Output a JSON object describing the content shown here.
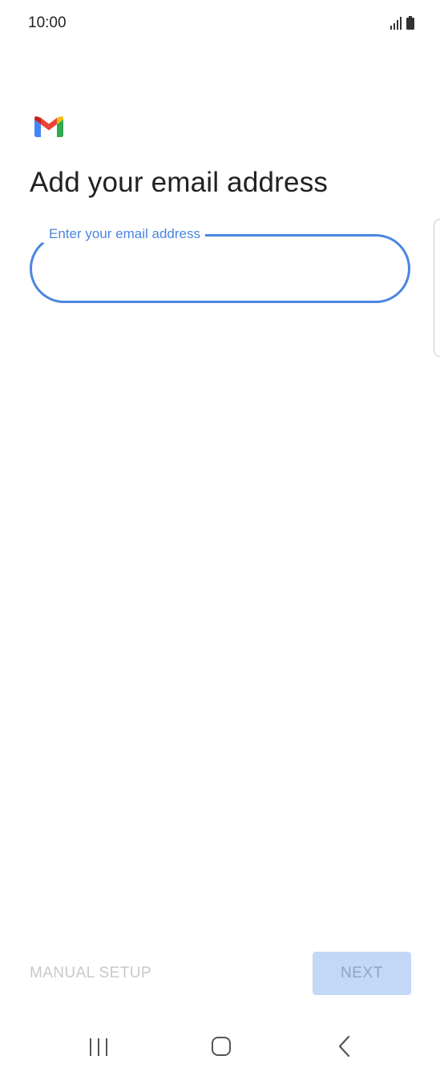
{
  "status_bar": {
    "time": "10:00",
    "icons": [
      "signal-icon",
      "battery-icon"
    ]
  },
  "app": {
    "logo": "gmail-logo-icon"
  },
  "page": {
    "title": "Add your email address"
  },
  "email_field": {
    "label": "Enter your email address",
    "value": "",
    "accent_color": "#4a86e0"
  },
  "actions": {
    "manual_setup_label": "MANUAL SETUP",
    "next_label": "NEXT",
    "next_bg_color": "#c3d7f6"
  },
  "nav_bar": {
    "icons": [
      "recents-icon",
      "home-icon",
      "back-icon"
    ]
  }
}
